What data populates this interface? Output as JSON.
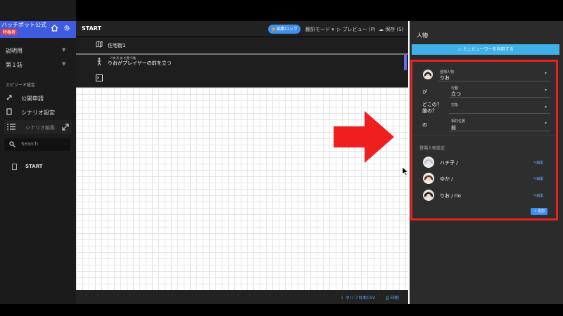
{
  "sidebar": {
    "brand_title": "ハッチポット公式",
    "brand_badge": "特権者",
    "sections": [
      {
        "label": "説明用"
      },
      {
        "label": "第１話"
      }
    ],
    "episode_settings_heading": "エピソード設定",
    "items": [
      {
        "label": "公開申請"
      },
      {
        "label": "シナリオ設定"
      },
      {
        "label": "シナリオ編集"
      }
    ],
    "search_placeholder": "Search",
    "tree_item": "START"
  },
  "topbar": {
    "title": "START",
    "lock_label": "編集ロック",
    "translate_label": "翻訳モード ▾",
    "preview_label": "プレビュー (P)",
    "save_label": "保存 (S)"
  },
  "rows": [
    {
      "text": "住宅街1",
      "icon": "map-icon"
    },
    {
      "text": "りおがプレイヤーの前を立つ",
      "ruby": "人物  形  体  位置 行動",
      "icon": "walk-icon"
    },
    {
      "text": "",
      "icon": "terminal-icon"
    }
  ],
  "bottombar": {
    "csv_label": "セリフ台本CSV",
    "print_label": "印刷"
  },
  "panel": {
    "title": "人物",
    "mini_viewer_label": "ミニビューワーを利用する",
    "character_label": "登場人物",
    "character_value": "りお",
    "ga": "が",
    "action_label": "行動",
    "action_value": "立つ",
    "where_label": "どこの？\n誰の？",
    "where_1": "どこの？",
    "where_2": "誰の？",
    "target_label": "対象",
    "target_value": "",
    "no": "の",
    "relpos_label": "相対位置",
    "relpos_value": "前",
    "cast_heading": "登場人物設定",
    "cast": [
      {
        "name": "ハチ子 /",
        "edit": "編集"
      },
      {
        "name": "ゆか /",
        "edit": "編集"
      },
      {
        "name": "りお / rio",
        "edit": "編集"
      }
    ],
    "add_label": "+ 追加"
  },
  "colors": {
    "accent": "#3f8ef0",
    "highlight": "#e8221f",
    "mini_button": "#3fb0e8"
  }
}
